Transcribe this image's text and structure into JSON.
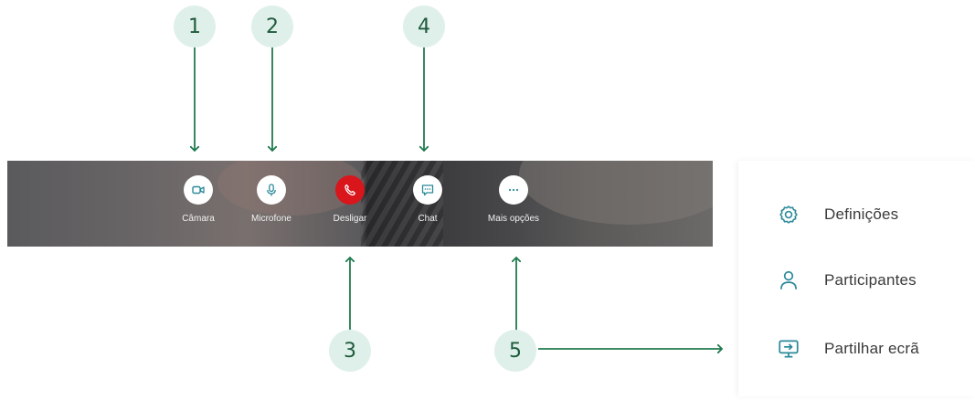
{
  "callouts": [
    "1",
    "2",
    "3",
    "4",
    "5"
  ],
  "controls": {
    "camera": {
      "label": "Câmara",
      "icon": "video-camera-icon"
    },
    "microphone": {
      "label": "Microfone",
      "icon": "microphone-icon"
    },
    "hangup": {
      "label": "Desligar",
      "icon": "phone-hangup-icon"
    },
    "chat": {
      "label": "Chat",
      "icon": "chat-icon"
    },
    "more": {
      "label": "Mais opções",
      "icon": "more-horizontal-icon"
    }
  },
  "menu": {
    "items": [
      {
        "label": "Definições",
        "icon": "gear-icon"
      },
      {
        "label": "Participantes",
        "icon": "person-icon"
      },
      {
        "label": "Partilhar ecrã",
        "icon": "screen-share-icon"
      }
    ]
  },
  "colors": {
    "accent_green": "#1f7a4e",
    "callout_bg": "#dff0ea",
    "hangup_red": "#d8161c",
    "icon_teal": "#2c8a9a"
  }
}
